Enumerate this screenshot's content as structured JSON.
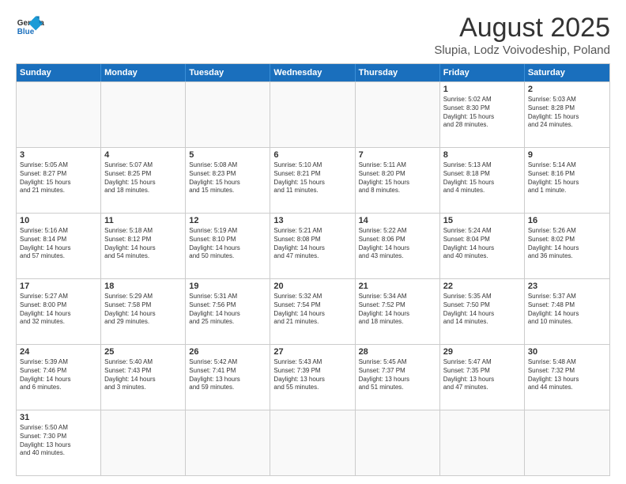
{
  "header": {
    "logo_general": "General",
    "logo_blue": "Blue",
    "month_title": "August 2025",
    "location": "Slupia, Lodz Voivodeship, Poland"
  },
  "weekdays": [
    "Sunday",
    "Monday",
    "Tuesday",
    "Wednesday",
    "Thursday",
    "Friday",
    "Saturday"
  ],
  "weeks": [
    [
      {
        "day": "",
        "info": ""
      },
      {
        "day": "",
        "info": ""
      },
      {
        "day": "",
        "info": ""
      },
      {
        "day": "",
        "info": ""
      },
      {
        "day": "",
        "info": ""
      },
      {
        "day": "1",
        "info": "Sunrise: 5:02 AM\nSunset: 8:30 PM\nDaylight: 15 hours\nand 28 minutes."
      },
      {
        "day": "2",
        "info": "Sunrise: 5:03 AM\nSunset: 8:28 PM\nDaylight: 15 hours\nand 24 minutes."
      }
    ],
    [
      {
        "day": "3",
        "info": "Sunrise: 5:05 AM\nSunset: 8:27 PM\nDaylight: 15 hours\nand 21 minutes."
      },
      {
        "day": "4",
        "info": "Sunrise: 5:07 AM\nSunset: 8:25 PM\nDaylight: 15 hours\nand 18 minutes."
      },
      {
        "day": "5",
        "info": "Sunrise: 5:08 AM\nSunset: 8:23 PM\nDaylight: 15 hours\nand 15 minutes."
      },
      {
        "day": "6",
        "info": "Sunrise: 5:10 AM\nSunset: 8:21 PM\nDaylight: 15 hours\nand 11 minutes."
      },
      {
        "day": "7",
        "info": "Sunrise: 5:11 AM\nSunset: 8:20 PM\nDaylight: 15 hours\nand 8 minutes."
      },
      {
        "day": "8",
        "info": "Sunrise: 5:13 AM\nSunset: 8:18 PM\nDaylight: 15 hours\nand 4 minutes."
      },
      {
        "day": "9",
        "info": "Sunrise: 5:14 AM\nSunset: 8:16 PM\nDaylight: 15 hours\nand 1 minute."
      }
    ],
    [
      {
        "day": "10",
        "info": "Sunrise: 5:16 AM\nSunset: 8:14 PM\nDaylight: 14 hours\nand 57 minutes."
      },
      {
        "day": "11",
        "info": "Sunrise: 5:18 AM\nSunset: 8:12 PM\nDaylight: 14 hours\nand 54 minutes."
      },
      {
        "day": "12",
        "info": "Sunrise: 5:19 AM\nSunset: 8:10 PM\nDaylight: 14 hours\nand 50 minutes."
      },
      {
        "day": "13",
        "info": "Sunrise: 5:21 AM\nSunset: 8:08 PM\nDaylight: 14 hours\nand 47 minutes."
      },
      {
        "day": "14",
        "info": "Sunrise: 5:22 AM\nSunset: 8:06 PM\nDaylight: 14 hours\nand 43 minutes."
      },
      {
        "day": "15",
        "info": "Sunrise: 5:24 AM\nSunset: 8:04 PM\nDaylight: 14 hours\nand 40 minutes."
      },
      {
        "day": "16",
        "info": "Sunrise: 5:26 AM\nSunset: 8:02 PM\nDaylight: 14 hours\nand 36 minutes."
      }
    ],
    [
      {
        "day": "17",
        "info": "Sunrise: 5:27 AM\nSunset: 8:00 PM\nDaylight: 14 hours\nand 32 minutes."
      },
      {
        "day": "18",
        "info": "Sunrise: 5:29 AM\nSunset: 7:58 PM\nDaylight: 14 hours\nand 29 minutes."
      },
      {
        "day": "19",
        "info": "Sunrise: 5:31 AM\nSunset: 7:56 PM\nDaylight: 14 hours\nand 25 minutes."
      },
      {
        "day": "20",
        "info": "Sunrise: 5:32 AM\nSunset: 7:54 PM\nDaylight: 14 hours\nand 21 minutes."
      },
      {
        "day": "21",
        "info": "Sunrise: 5:34 AM\nSunset: 7:52 PM\nDaylight: 14 hours\nand 18 minutes."
      },
      {
        "day": "22",
        "info": "Sunrise: 5:35 AM\nSunset: 7:50 PM\nDaylight: 14 hours\nand 14 minutes."
      },
      {
        "day": "23",
        "info": "Sunrise: 5:37 AM\nSunset: 7:48 PM\nDaylight: 14 hours\nand 10 minutes."
      }
    ],
    [
      {
        "day": "24",
        "info": "Sunrise: 5:39 AM\nSunset: 7:46 PM\nDaylight: 14 hours\nand 6 minutes."
      },
      {
        "day": "25",
        "info": "Sunrise: 5:40 AM\nSunset: 7:43 PM\nDaylight: 14 hours\nand 3 minutes."
      },
      {
        "day": "26",
        "info": "Sunrise: 5:42 AM\nSunset: 7:41 PM\nDaylight: 13 hours\nand 59 minutes."
      },
      {
        "day": "27",
        "info": "Sunrise: 5:43 AM\nSunset: 7:39 PM\nDaylight: 13 hours\nand 55 minutes."
      },
      {
        "day": "28",
        "info": "Sunrise: 5:45 AM\nSunset: 7:37 PM\nDaylight: 13 hours\nand 51 minutes."
      },
      {
        "day": "29",
        "info": "Sunrise: 5:47 AM\nSunset: 7:35 PM\nDaylight: 13 hours\nand 47 minutes."
      },
      {
        "day": "30",
        "info": "Sunrise: 5:48 AM\nSunset: 7:32 PM\nDaylight: 13 hours\nand 44 minutes."
      }
    ],
    [
      {
        "day": "31",
        "info": "Sunrise: 5:50 AM\nSunset: 7:30 PM\nDaylight: 13 hours\nand 40 minutes."
      },
      {
        "day": "",
        "info": ""
      },
      {
        "day": "",
        "info": ""
      },
      {
        "day": "",
        "info": ""
      },
      {
        "day": "",
        "info": ""
      },
      {
        "day": "",
        "info": ""
      },
      {
        "day": "",
        "info": ""
      }
    ]
  ]
}
